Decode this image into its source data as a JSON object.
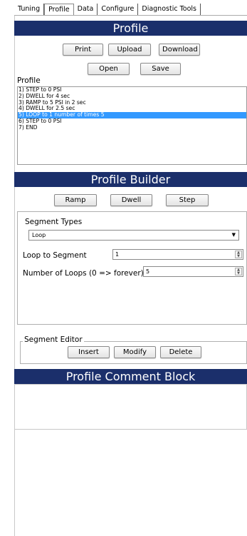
{
  "tabs": [
    "Tuning",
    "Profile",
    "Data",
    "Configure",
    "Diagnostic Tools"
  ],
  "profile": {
    "title": "Profile",
    "buttons": {
      "print": "Print",
      "upload": "Upload",
      "download": "Download",
      "open": "Open",
      "save": "Save"
    },
    "list_label": "Profile",
    "items": [
      "1) STEP to 0 PSI",
      "2) DWELL for 4 sec",
      "3) RAMP to 5 PSI in 2 sec",
      "4) DWELL for 2.5 sec",
      "5) LOOP to 1 number of times 5",
      "6) STEP to 0 PSI",
      "7) END"
    ],
    "selected_index": 4
  },
  "builder": {
    "title": "Profile Builder",
    "buttons": {
      "ramp": "Ramp",
      "dwell": "Dwell",
      "step": "Step"
    },
    "segment_types_label": "Segment Types",
    "segment_type_value": "Loop",
    "loop_to_label": "Loop to Segment",
    "loop_to_value": "1",
    "num_loops_label": "Number of Loops (0 => forever)",
    "num_loops_value": "5"
  },
  "editor": {
    "title": "Segment Editor",
    "buttons": {
      "insert": "Insert",
      "modify": "Modify",
      "delete": "Delete"
    }
  },
  "comment": {
    "title": "Profile Comment Block",
    "text": ""
  },
  "colors": {
    "banner": "#1b2f6b",
    "selection": "#3399ff"
  }
}
